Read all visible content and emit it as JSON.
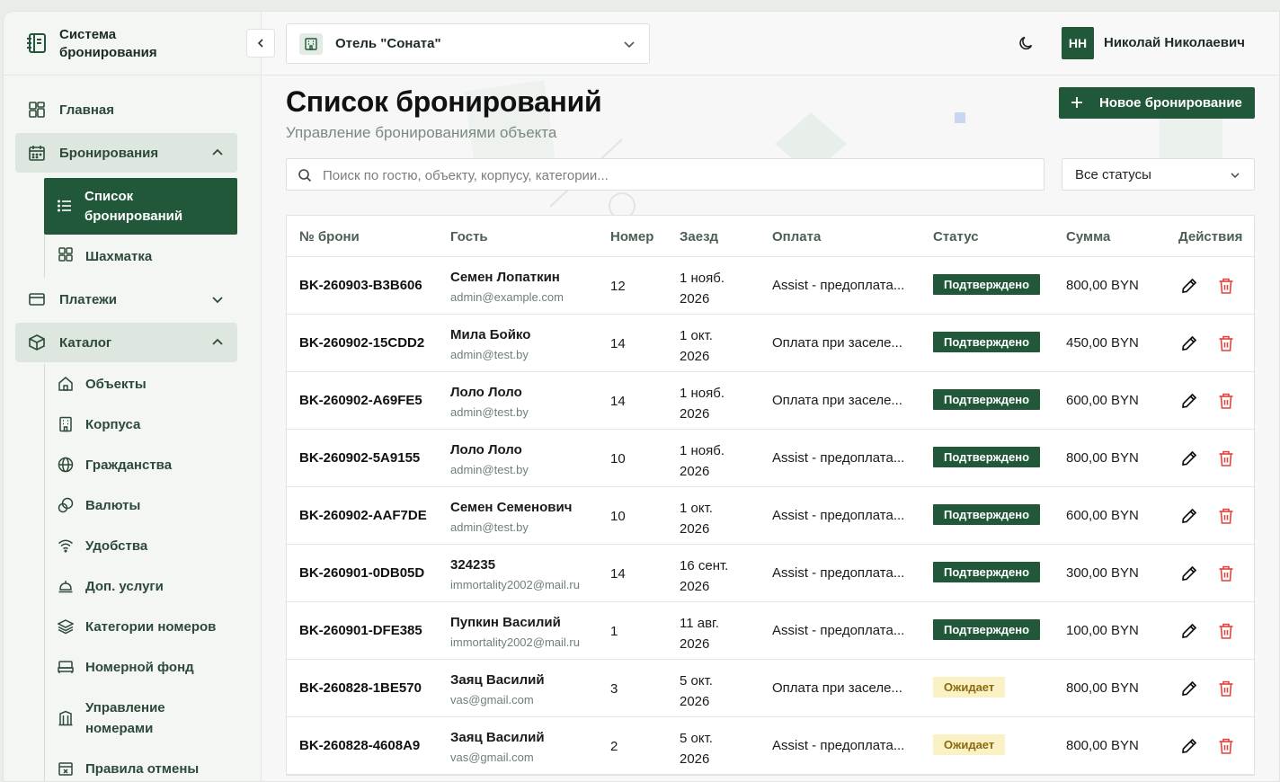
{
  "brand": {
    "line1": "Система",
    "line2": "бронирования"
  },
  "sidebar": {
    "home": "Главная",
    "bookings": "Бронирования",
    "bookings_list": "Список бронирований",
    "chessboard": "Шахматка",
    "payments": "Платежи",
    "catalog": "Каталог",
    "catalog_items": [
      {
        "label": "Объекты",
        "icon": "home-icon"
      },
      {
        "label": "Корпуса",
        "icon": "building-icon"
      },
      {
        "label": "Гражданства",
        "icon": "globe-icon"
      },
      {
        "label": "Валюты",
        "icon": "coins-icon"
      },
      {
        "label": "Удобства",
        "icon": "wifi-icon"
      },
      {
        "label": "Доп. услуги",
        "icon": "service-bell-icon"
      },
      {
        "label": "Категории номеров",
        "icon": "layers-icon"
      },
      {
        "label": "Номерной фонд",
        "icon": "bed-icon"
      },
      {
        "label": "Управление номерами",
        "icon": "columns-icon"
      },
      {
        "label": "Правила отмены",
        "icon": "calendar-x-icon"
      }
    ]
  },
  "topbar": {
    "hotel": "Отель \"Соната\"",
    "avatar_initials": "НН",
    "user_name": "Николай Николаевич"
  },
  "page": {
    "title": "Список бронирований",
    "subtitle": "Управление бронированиями объекта",
    "new_button": "Новое бронирование",
    "search_placeholder": "Поиск по гостю, объекту, корпусу, категории...",
    "status_filter": "Все статусы"
  },
  "table": {
    "headers": [
      "№ брони",
      "Гость",
      "Номер",
      "Заезд",
      "Оплата",
      "Статус",
      "Сумма",
      "Действия"
    ],
    "rows": [
      {
        "id": "BK-260903-B3B606",
        "guest": "Семен Лопаткин",
        "email": "admin@example.com",
        "room": "12",
        "date1": "1 нояб.",
        "date2": "2026",
        "payment": "Assist - предоплата...",
        "status": "Подтверждено",
        "status_kind": "ok",
        "sum": "800,00 BYN"
      },
      {
        "id": "BK-260902-15CDD2",
        "guest": "Мила Бойко",
        "email": "admin@test.by",
        "room": "14",
        "date1": "1 окт.",
        "date2": "2026",
        "payment": "Оплата при заселе...",
        "status": "Подтверждено",
        "status_kind": "ok",
        "sum": "450,00 BYN"
      },
      {
        "id": "BK-260902-A69FE5",
        "guest": "Лоло Лоло",
        "email": "admin@test.by",
        "room": "14",
        "date1": "1 нояб.",
        "date2": "2026",
        "payment": "Оплата при заселе...",
        "status": "Подтверждено",
        "status_kind": "ok",
        "sum": "600,00 BYN"
      },
      {
        "id": "BK-260902-5A9155",
        "guest": "Лоло Лоло",
        "email": "admin@test.by",
        "room": "10",
        "date1": "1 нояб.",
        "date2": "2026",
        "payment": "Assist - предоплата...",
        "status": "Подтверждено",
        "status_kind": "ok",
        "sum": "800,00 BYN"
      },
      {
        "id": "BK-260902-AAF7DE",
        "guest": "Семен Семенович",
        "email": "admin@test.by",
        "room": "10",
        "date1": "1 окт.",
        "date2": "2026",
        "payment": "Assist - предоплата...",
        "status": "Подтверждено",
        "status_kind": "ok",
        "sum": "600,00 BYN"
      },
      {
        "id": "BK-260901-0DB05D",
        "guest": "324235",
        "email": "immortality2002@mail.ru",
        "room": "14",
        "date1": "16 сент.",
        "date2": "2026",
        "payment": "Assist - предоплата...",
        "status": "Подтверждено",
        "status_kind": "ok",
        "sum": "300,00 BYN"
      },
      {
        "id": "BK-260901-DFE385",
        "guest": "Пупкин Василий",
        "email": "immortality2002@mail.ru",
        "room": "1",
        "date1": "11 авг.",
        "date2": "2026",
        "payment": "Assist - предоплата...",
        "status": "Подтверждено",
        "status_kind": "ok",
        "sum": "100,00 BYN"
      },
      {
        "id": "BK-260828-1BE570",
        "guest": "Заяц Василий",
        "email": "vas@gmail.com",
        "room": "3",
        "date1": "5 окт.",
        "date2": "2026",
        "payment": "Оплата при заселе...",
        "status": "Ожидает",
        "status_kind": "wait",
        "sum": "800,00 BYN"
      },
      {
        "id": "BK-260828-4608A9",
        "guest": "Заяц Василий",
        "email": "vas@gmail.com",
        "room": "2",
        "date1": "5 окт.",
        "date2": "2026",
        "payment": "Assist - предоплата...",
        "status": "Ожидает",
        "status_kind": "wait",
        "sum": "800,00 BYN"
      }
    ]
  },
  "colors": {
    "primary": "#22583a",
    "danger": "#e0443b",
    "pending_bg": "#faf1c4"
  }
}
